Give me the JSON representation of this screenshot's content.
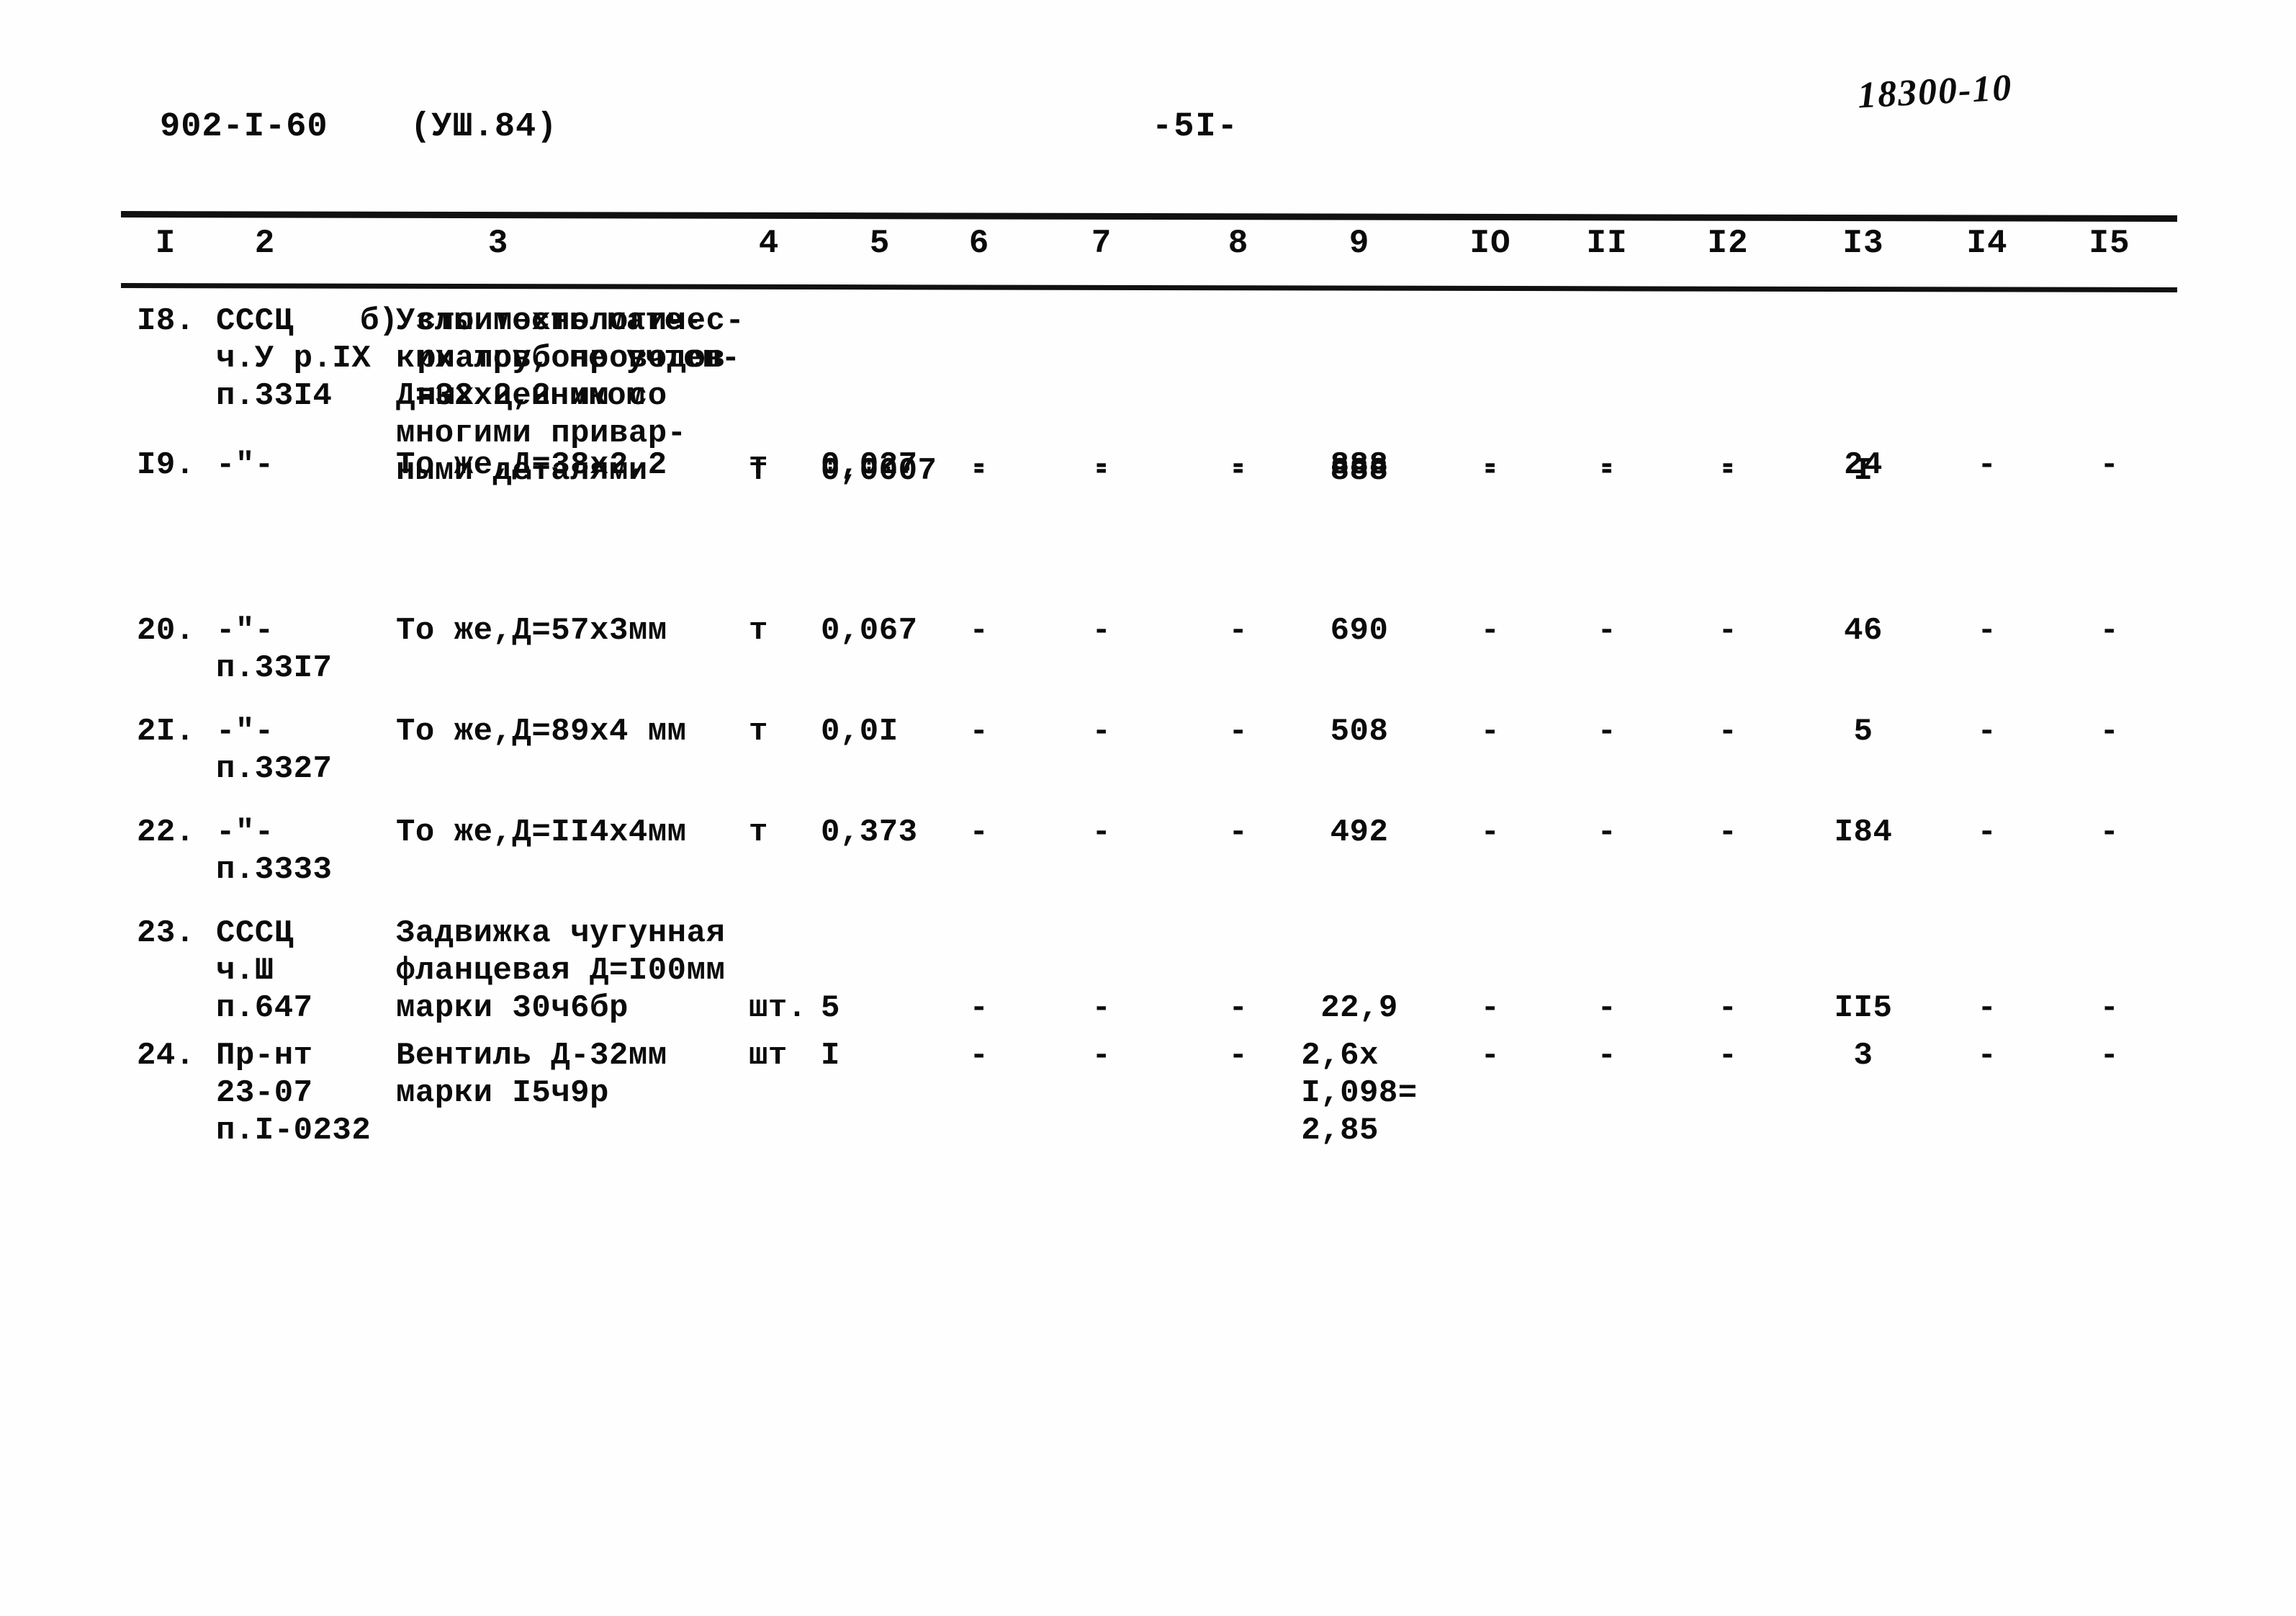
{
  "header": {
    "doc_code": "902-I-60",
    "doc_revision": "(УШ.84)",
    "page_label": "-5I-",
    "archive_stamp": "18300-10"
  },
  "table": {
    "column_headers": [
      "I",
      "2",
      "3",
      "4",
      "5",
      "6",
      "7",
      "8",
      "9",
      "IO",
      "II",
      "I2",
      "I3",
      "I4",
      "I5"
    ],
    "intro_note": "б) стоимость мате-\n   риалов, не учтен-\n   ных ценником",
    "rows": [
      {
        "num": "I8.",
        "source": "СССЦ\nч.У р.IX\nп.33I4",
        "description": "Узлы технологичес-\nких трубопроводов\nД=32х2,2 мм со\nмногими привар-\nными деталями",
        "unit": "т",
        "qty": "0,0007",
        "c6": "-",
        "c7": "-",
        "c8": "-",
        "c9": "888",
        "c10": "-",
        "c11": "-",
        "c12": "-",
        "c13": "I",
        "c14": "",
        "c15": ""
      },
      {
        "num": "I9.",
        "source": "-\"-",
        "description": "То же,Д=38х2,2",
        "unit": "т",
        "qty": "0,027",
        "c6": "-",
        "c7": "-",
        "c8": "-",
        "c9": "888",
        "c10": "-",
        "c11": "-",
        "c12": "-",
        "c13": "24",
        "c14": "-",
        "c15": "-"
      },
      {
        "num": "20.",
        "source": "-\"-\nп.33I7",
        "description": "То же,Д=57х3мм",
        "unit": "т",
        "qty": "0,067",
        "c6": "-",
        "c7": "-",
        "c8": "-",
        "c9": "690",
        "c10": "-",
        "c11": "-",
        "c12": "-",
        "c13": "46",
        "c14": "-",
        "c15": "-"
      },
      {
        "num": "2I.",
        "source": "-\"-\nп.3327",
        "description": "То же,Д=89х4 мм",
        "unit": "т",
        "qty": "0,0I",
        "c6": "-",
        "c7": "-",
        "c8": "-",
        "c9": "508",
        "c10": "-",
        "c11": "-",
        "c12": "-",
        "c13": "5",
        "c14": "-",
        "c15": "-"
      },
      {
        "num": "22.",
        "source": "-\"-\nп.3333",
        "description": "То же,Д=II4х4мм",
        "unit": "т",
        "qty": "0,373",
        "c6": "-",
        "c7": "-",
        "c8": "-",
        "c9": "492",
        "c10": "-",
        "c11": "-",
        "c12": "-",
        "c13": "I84",
        "c14": "-",
        "c15": "-"
      },
      {
        "num": "23.",
        "source": "СССЦ\nч.Ш\nп.647",
        "description": "Задвижка чугунная\nфланцевая Д=I00мм\nмарки 30ч6бр",
        "unit": "шт.",
        "qty": "5",
        "c6": "-",
        "c7": "-",
        "c8": "-",
        "c9": "22,9",
        "c10": "-",
        "c11": "-",
        "c12": "-",
        "c13": "II5",
        "c14": "-",
        "c15": "-"
      },
      {
        "num": "24.",
        "source": "Пр-нт\n23-07\nп.I-0232",
        "description": "Вентиль Д-32мм\nмарки I5ч9р",
        "unit": "шт",
        "qty": "I",
        "c6": "-",
        "c7": "-",
        "c8": "-",
        "c9": "2,6х\nI,098=\n2,85",
        "c10": "-",
        "c11": "-",
        "c12": "-",
        "c13": "3",
        "c14": "-",
        "c15": "-"
      }
    ]
  },
  "layout": {
    "col_x": [
      230,
      368,
      692,
      1068,
      1222,
      1360,
      1530,
      1720,
      1888,
      2070,
      2232,
      2400,
      2588,
      2760,
      2930
    ],
    "row_top": [
      0,
      200,
      430,
      570,
      710,
      850,
      1020,
      1230
    ],
    "ink_color": "#0b0b0b"
  }
}
